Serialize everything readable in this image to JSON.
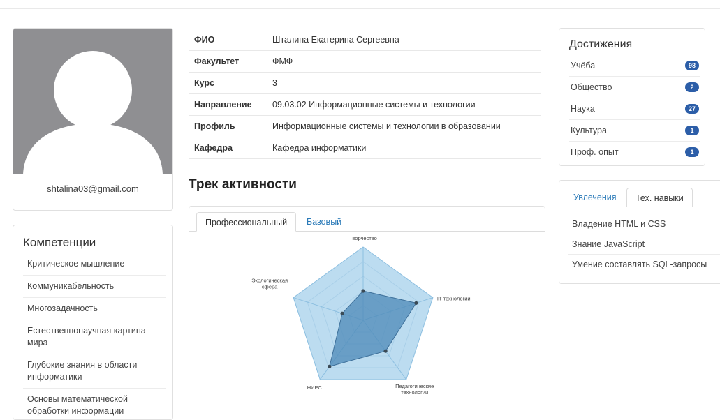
{
  "profile": {
    "email": "shtalina03@gmail.com"
  },
  "info": [
    {
      "label": "ФИО",
      "value": "Шталина Екатерина Сергеевна"
    },
    {
      "label": "Факультет",
      "value": "ФМФ"
    },
    {
      "label": "Курс",
      "value": "3"
    },
    {
      "label": "Направление",
      "value": "09.03.02 Информационные системы и технологии"
    },
    {
      "label": "Профиль",
      "value": "Информационные системы и технологии в образовании"
    },
    {
      "label": "Кафедра",
      "value": "Кафедра информатики"
    }
  ],
  "competencies": {
    "title": "Компетенции",
    "items": [
      "Критическое мышление",
      "Коммуникабельность",
      "Многозадачность",
      "Естественнонаучная картина мира",
      "Глубокие знания в области информатики",
      "Основы математической обработки информации"
    ]
  },
  "track": {
    "title": "Трек активности",
    "tabs": [
      {
        "label": "Профессиональный",
        "active": true
      },
      {
        "label": "Базовый",
        "active": false
      }
    ]
  },
  "chart_data": {
    "type": "radar",
    "axes": [
      {
        "label": "Творчество",
        "max": 1.0
      },
      {
        "label": "IT-технологии",
        "max": 1.0
      },
      {
        "label": "Педагогические технологии",
        "max": 1.0
      },
      {
        "label": "НИРС",
        "max": 1.0
      },
      {
        "label": "Экологическая сфера",
        "max": 1.0
      }
    ],
    "series": [
      {
        "values": [
          0.4,
          0.76,
          0.52,
          0.78,
          0.3
        ]
      }
    ],
    "levels": 5,
    "colors": {
      "area": "#4e89b8",
      "rings": "#a9cfe8",
      "outline": "#8dbfe0",
      "point": "#3a4a56"
    }
  },
  "achievements": {
    "title": "Достижения",
    "items": [
      {
        "label": "Учёба",
        "count": "98"
      },
      {
        "label": "Общество",
        "count": "2"
      },
      {
        "label": "Наука",
        "count": "27"
      },
      {
        "label": "Культура",
        "count": "1"
      },
      {
        "label": "Проф. опыт",
        "count": "1"
      }
    ]
  },
  "skills": {
    "tabs": [
      {
        "label": "Увлечения",
        "active": false
      },
      {
        "label": "Тех. навыки",
        "active": true
      }
    ],
    "items": [
      "Владение HTML и CSS",
      "Знание JavaScript",
      "Умение составлять SQL-запросы"
    ]
  }
}
